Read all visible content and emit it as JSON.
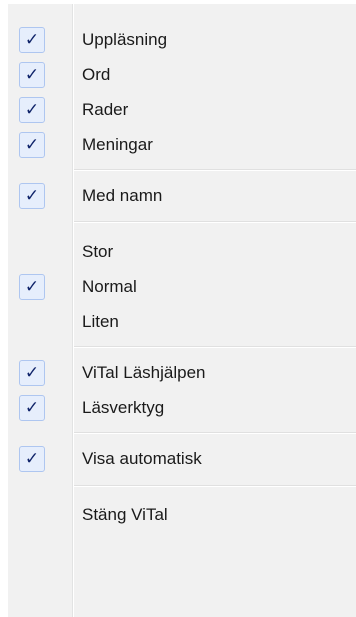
{
  "menu": {
    "items": [
      {
        "label": "Uppläsning",
        "checked": true
      },
      {
        "label": "Ord",
        "checked": true
      },
      {
        "label": "Rader",
        "checked": true
      },
      {
        "label": "Meningar",
        "checked": true
      },
      {
        "label": "Med namn",
        "checked": true
      },
      {
        "label": "Stor",
        "checked": false
      },
      {
        "label": "Normal",
        "checked": true
      },
      {
        "label": "Liten",
        "checked": false
      },
      {
        "label": "ViTal Läshjälpen",
        "checked": true
      },
      {
        "label": "Läsverktyg",
        "checked": true
      },
      {
        "label": "Visa automatisk",
        "checked": true
      },
      {
        "label": "Stäng ViTal",
        "checked": false
      }
    ],
    "check_glyph": "✓",
    "colors": {
      "background": "#f1f1f1",
      "check_fill": "#e6eefc",
      "check_border": "#aec6f0",
      "check_mark": "#10246a"
    }
  }
}
